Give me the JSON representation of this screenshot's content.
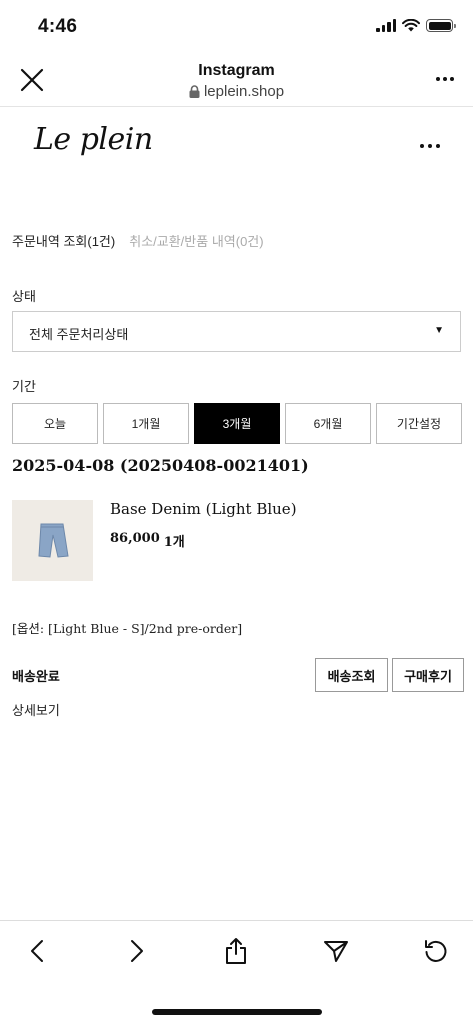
{
  "status_bar": {
    "time": "4:46"
  },
  "browser": {
    "title": "Instagram",
    "url": "leplein.shop"
  },
  "site": {
    "logo": "Le plein"
  },
  "order_tabs": {
    "active": "주문내역 조회(1건)",
    "inactive": "취소/교환/반품 내역(0건)"
  },
  "status_section": {
    "label": "상태",
    "select_value": "전체 주문처리상태",
    "select_arrow": "▼"
  },
  "period_section": {
    "label": "기간",
    "buttons": [
      "오늘",
      "1개월",
      "3개월",
      "6개월",
      "기간설정"
    ],
    "active": "3개월"
  },
  "order": {
    "date": "2025-04-08 (20250408-0021401)",
    "product_name": "Base Denim (Light Blue)",
    "price": "86,000",
    "quantity": "1개",
    "option": "[옵션: [Light Blue - S]/2nd pre-order]",
    "delivery_status": "배송완료",
    "track_button": "배송조회",
    "review_button": "구매후기",
    "detail_link": "상세보기"
  },
  "colors": {
    "active_bg": "#000000",
    "product_bg": "#efebe5",
    "denim": "#8aa5c6"
  },
  "icons": [
    "close-icon",
    "lock-icon",
    "more-icon",
    "back-icon",
    "forward-icon",
    "share-icon",
    "send-icon",
    "reload-icon"
  ]
}
